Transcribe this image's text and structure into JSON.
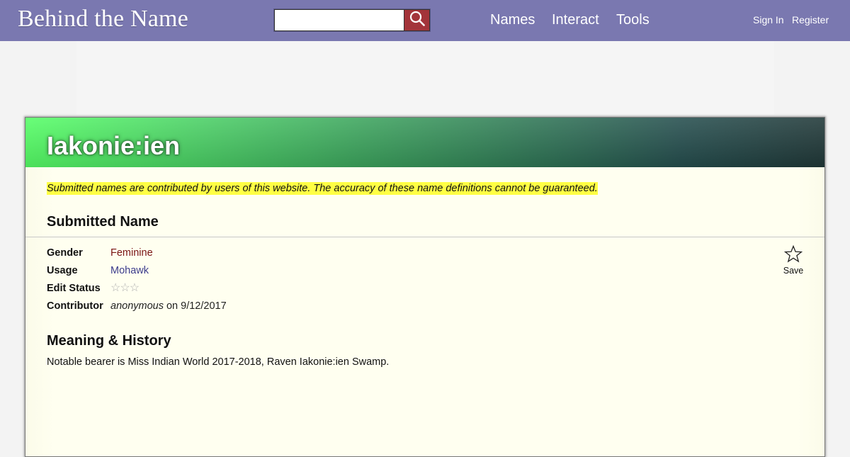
{
  "header": {
    "logo_text": "Behind the Name",
    "search": {
      "placeholder": "",
      "value": "",
      "button_icon": "magnifier-icon"
    },
    "nav": [
      {
        "label": "Names"
      },
      {
        "label": "Interact"
      },
      {
        "label": "Tools"
      }
    ],
    "account": {
      "sign_in": "Sign In",
      "register": "Register"
    },
    "colors": {
      "bar": "#7a78b0",
      "search_button": "#a3343a"
    }
  },
  "page": {
    "title": "Iakonie:ien",
    "disclaimer": "Submitted names are contributed by users of this website. The accuracy of these name definitions cannot be guaranteed.",
    "section_submitted": "Submitted Name",
    "info": {
      "gender_label": "Gender",
      "gender_value": "Feminine",
      "usage_label": "Usage",
      "usage_value": "Mohawk",
      "edit_status_label": "Edit Status",
      "edit_status_stars": "☆☆☆",
      "contributor_label": "Contributor",
      "contributor_name": "anonymous",
      "contributor_date_text": " on 9/12/2017"
    },
    "save": {
      "label": "Save",
      "icon": "star-outline-icon"
    },
    "section_meaning": "Meaning & History",
    "meaning_text": "Notable bearer is Miss Indian World 2017-2018, Raven Iakonie:ien Swamp.",
    "colors": {
      "disclaimer_highlight": "#ffff44",
      "card_bg": "#fffff0",
      "header_gradient_start": "#55ff66",
      "header_gradient_end": "#203838"
    }
  }
}
